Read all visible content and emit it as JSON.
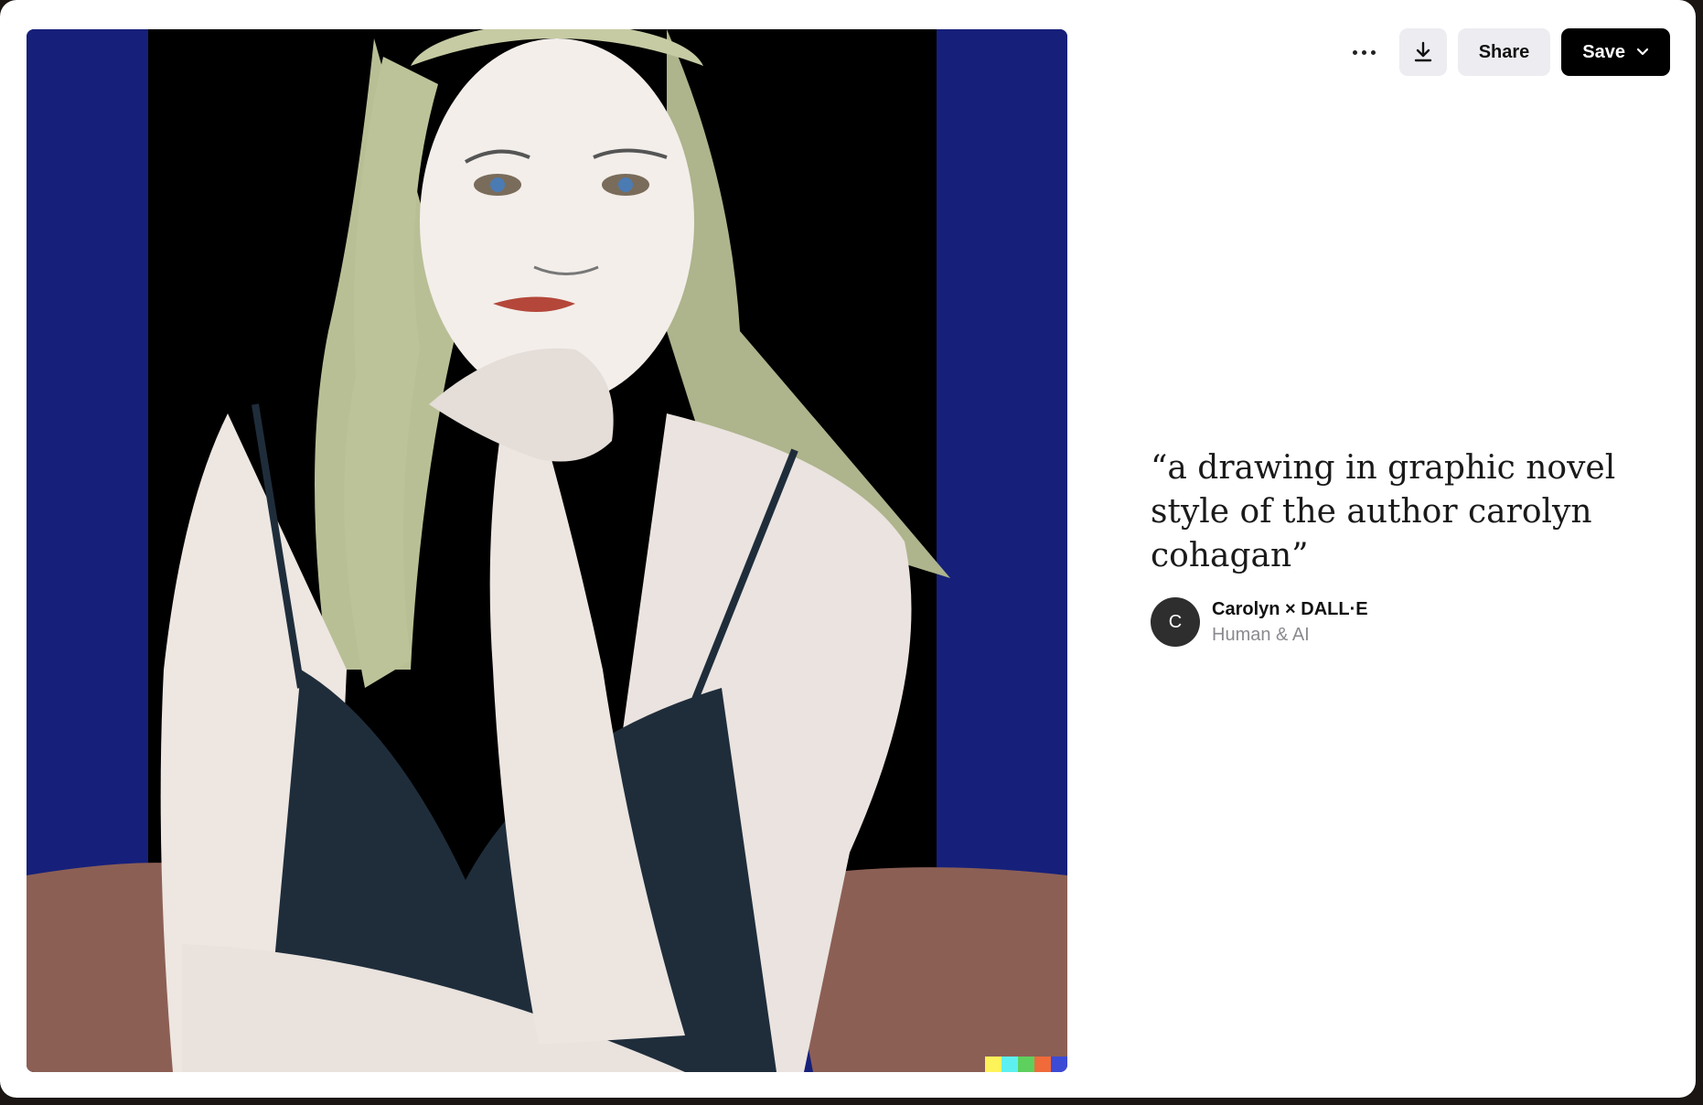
{
  "toolbar": {
    "more_icon": "more-horizontal-icon",
    "download_icon": "download-icon",
    "share_label": "Share",
    "save_label": "Save",
    "save_chevron_icon": "chevron-down-icon"
  },
  "prompt": {
    "text": "“a drawing in graphic novel style of the author carolyn cohagan”"
  },
  "author": {
    "avatar_initial": "C",
    "name": "Carolyn × DALL·E",
    "subtitle": "Human & AI"
  },
  "colors": {
    "save_bg": "#000000",
    "share_bg": "#ececf1",
    "artwork_blue": "#16207a",
    "watermark": [
      "#fff35a",
      "#5ef0f0",
      "#5ed05e",
      "#f06a3a",
      "#3b4bd6"
    ]
  }
}
